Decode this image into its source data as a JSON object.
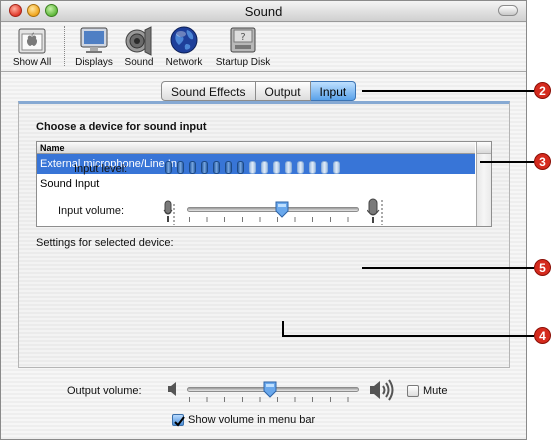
{
  "window": {
    "title": "Sound"
  },
  "toolbar": [
    {
      "label": "Show All",
      "icon": "apple-logo-icon"
    },
    {
      "label": "Displays",
      "icon": "display-icon"
    },
    {
      "label": "Sound",
      "icon": "speaker-icon"
    },
    {
      "label": "Network",
      "icon": "globe-icon"
    },
    {
      "label": "Startup Disk",
      "icon": "disk-icon"
    }
  ],
  "tabs": [
    {
      "label": "Sound Effects",
      "selected": false
    },
    {
      "label": "Output",
      "selected": false
    },
    {
      "label": "Input",
      "selected": true
    }
  ],
  "input_panel": {
    "heading": "Choose a device for sound input",
    "list_header": "Name",
    "devices": [
      {
        "name": "External microphone/Line In",
        "selected": true
      },
      {
        "name": "Sound Input",
        "selected": false
      }
    ],
    "settings_label": "Settings for selected device:",
    "input_level_label": "Input level:",
    "input_level": {
      "lit_segments": 7,
      "total_segments": 15
    },
    "input_volume_label": "Input volume:",
    "input_volume": 0.55
  },
  "output": {
    "volume_label": "Output volume:",
    "volume": 0.48,
    "mute_label": "Mute",
    "mute_checked": false,
    "menubar_label": "Show volume in menu bar",
    "menubar_checked": true
  },
  "callouts": [
    "2",
    "3",
    "5",
    "4"
  ],
  "colors": {
    "selection": "#3875d7",
    "tab_selected": "#5aa2ea",
    "callout": "#d52b1e"
  }
}
